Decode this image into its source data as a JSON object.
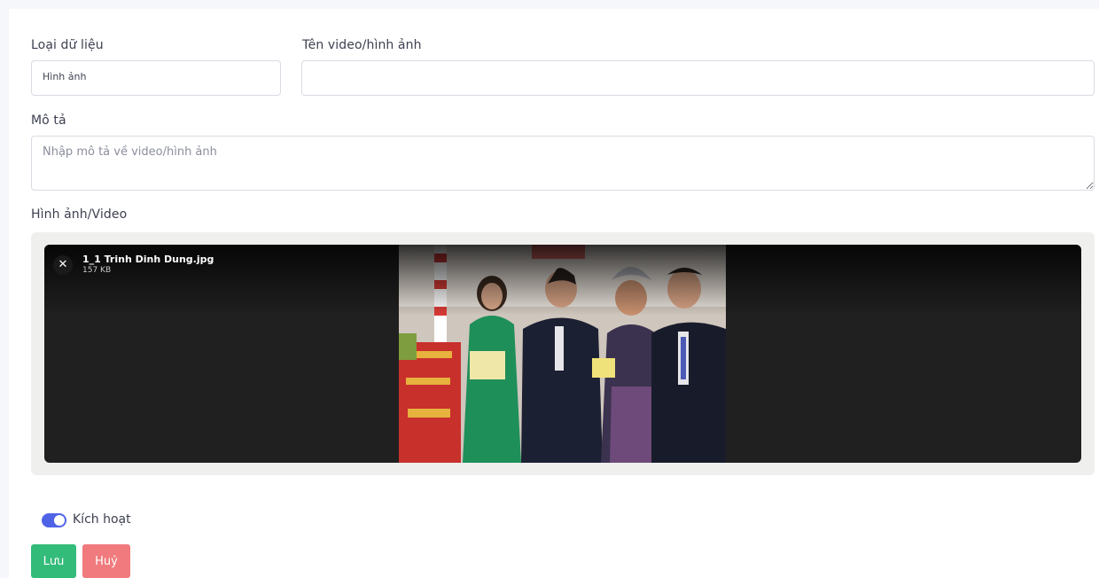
{
  "form": {
    "data_type_label": "Loại dữ liệu",
    "data_type_value": "Hình ảnh",
    "name_label": "Tên video/hình ảnh",
    "name_value": "",
    "description_label": "Mô tả",
    "description_placeholder": "Nhập mô tả về video/hình ảnh",
    "media_label": "Hình ảnh/Video"
  },
  "upload": {
    "remove_icon": "close-icon",
    "file_name": "1_1 Trinh Dinh Dung.jpg",
    "file_size": "157 KB"
  },
  "status": {
    "toggle_label": "Kích hoạt",
    "active": true
  },
  "actions": {
    "save_label": "Lưu",
    "cancel_label": "Huỷ"
  },
  "colors": {
    "accent": "#4f63e6",
    "save": "#33bb7a",
    "cancel": "#f07a7d"
  }
}
